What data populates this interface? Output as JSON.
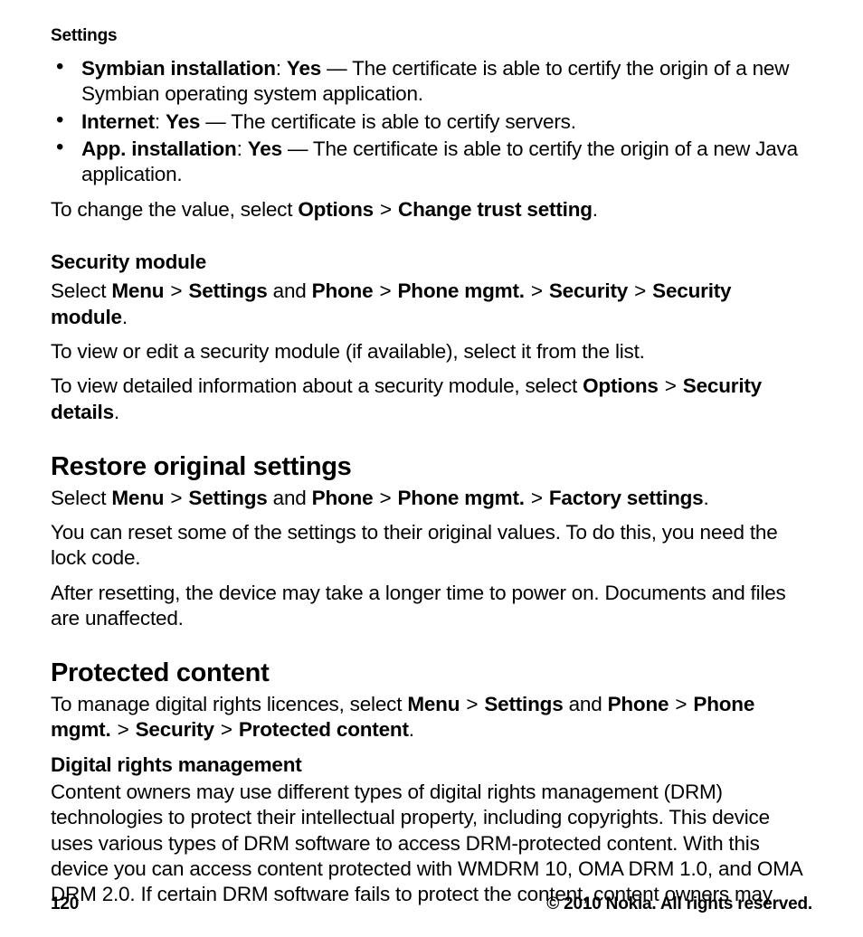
{
  "header": "Settings",
  "bullets": [
    {
      "label": "Symbian installation",
      "value": "Yes",
      "desc": " — The certificate is able to certify the origin of a new Symbian operating system application."
    },
    {
      "label": "Internet",
      "value": "Yes",
      "desc": " — The certificate is able to certify servers."
    },
    {
      "label": "App. installation",
      "value": "Yes",
      "desc": " — The certificate is able to certify the origin of a new Java application."
    }
  ],
  "trust_change_prefix": "To change the value, select ",
  "trust_change_options": "Options",
  "trust_change_gt": ">",
  "trust_change_target": "Change trust setting",
  "trust_change_suffix": ".",
  "secmod_heading": "Security module",
  "secmod_select": "Select ",
  "nav": {
    "menu": "Menu",
    "settings": "Settings",
    "and": " and ",
    "phone": "Phone",
    "phone_mgmt": "Phone mgmt.",
    "security": "Security",
    "security_module": "Security module",
    "factory_settings": "Factory settings",
    "protected_content": "Protected content",
    "options": "Options",
    "security_details": "Security details",
    "gt": ">"
  },
  "secmod_view": "To view or edit a security module (if available), select it from the list.",
  "secmod_detail_prefix": "To view detailed information about a security module, select ",
  "restore_heading": "Restore original settings",
  "restore_p1": "You can reset some of the settings to their original values. To do this, you need the lock code.",
  "restore_p2": "After resetting, the device may take a longer time to power on. Documents and files are unaffected.",
  "protected_heading": "Protected content",
  "protected_prefix": "To manage digital rights licences, select ",
  "drm_heading": "Digital rights management",
  "drm_body": "Content owners may use different types of digital rights management (DRM) technologies to protect their intellectual property, including copyrights. This device uses various types of DRM software to access DRM-protected content. With this device you can access content protected with WMDRM 10, OMA DRM 1.0, and OMA DRM 2.0. If certain DRM software fails to protect the content, content owners may",
  "footer": {
    "page": "120",
    "copy": "© 2010 Nokia. All rights reserved."
  },
  "punct": {
    "period": ".",
    "colon_space": ": "
  }
}
